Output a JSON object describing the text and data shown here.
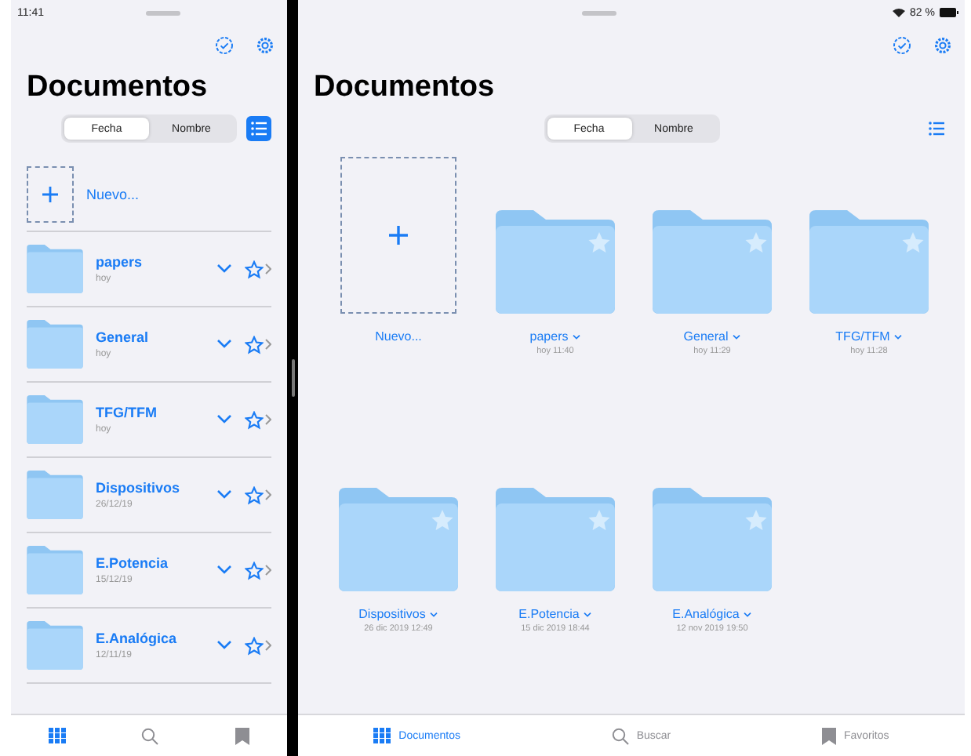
{
  "status_bar": {
    "time": "11:41",
    "battery": "82 %"
  },
  "left": {
    "title": "Documentos",
    "sort": [
      {
        "label": "Fecha",
        "selected": true
      },
      {
        "label": "Nombre",
        "selected": false
      }
    ],
    "list_view": true,
    "new_label": "Nuevo...",
    "folders": [
      {
        "name": "papers",
        "date": "hoy"
      },
      {
        "name": "General",
        "date": "hoy"
      },
      {
        "name": "TFG/TFM",
        "date": "hoy"
      },
      {
        "name": "Dispositivos",
        "date": "26/12/19"
      },
      {
        "name": "E.Potencia",
        "date": "15/12/19"
      },
      {
        "name": "E.Analógica",
        "date": "12/11/19"
      }
    ],
    "tab_bar": [
      {
        "selected": true
      },
      {
        "selected": false
      },
      {
        "selected": false
      }
    ]
  },
  "right": {
    "title": "Documentos",
    "sort": [
      {
        "label": "Fecha",
        "selected": true
      },
      {
        "label": "Nombre",
        "selected": false
      }
    ],
    "list_view": false,
    "new_label": "Nuevo...",
    "folders": [
      {
        "name": "papers",
        "date": "hoy 11:40"
      },
      {
        "name": "General",
        "date": "hoy 11:29"
      },
      {
        "name": "TFG/TFM",
        "date": "hoy 11:28"
      },
      {
        "name": "Dispositivos",
        "date": "26 dic 2019 12:49"
      },
      {
        "name": "E.Potencia",
        "date": "15 dic 2019 18:44"
      },
      {
        "name": "E.Analógica",
        "date": "12 nov 2019 19:50"
      }
    ],
    "tab_bar": [
      {
        "label": "Documentos",
        "selected": true
      },
      {
        "label": "Buscar",
        "selected": false
      },
      {
        "label": "Favoritos",
        "selected": false
      }
    ]
  }
}
